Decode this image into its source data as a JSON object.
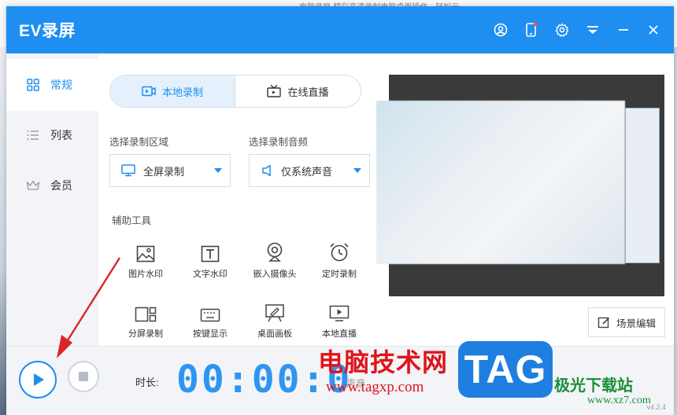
{
  "app": {
    "title": "EV录屏",
    "version": "v4.2.4"
  },
  "background_snippet": "电脑录屏·精彩高清录制电脑桌面操作，轻松云",
  "sidebar": {
    "items": [
      {
        "label": "常规",
        "icon": "grid-icon",
        "active": true
      },
      {
        "label": "列表",
        "icon": "list-icon",
        "active": false
      },
      {
        "label": "会员",
        "icon": "crown-icon",
        "active": false
      }
    ]
  },
  "mode_tabs": [
    {
      "label": "本地录制",
      "icon": "video-record-icon",
      "active": true
    },
    {
      "label": "在线直播",
      "icon": "tv-icon",
      "active": false
    }
  ],
  "record_area": {
    "label": "选择录制区域",
    "value": "全屏录制",
    "icon": "monitor-icon"
  },
  "record_audio": {
    "label": "选择录制音频",
    "value": "仅系统声音",
    "icon": "speaker-icon"
  },
  "tools": {
    "label": "辅助工具",
    "items": [
      {
        "label": "图片水印",
        "icon": "image-icon"
      },
      {
        "label": "文字水印",
        "icon": "text-icon"
      },
      {
        "label": "嵌入摄像头",
        "icon": "webcam-icon"
      },
      {
        "label": "定时录制",
        "icon": "alarm-clock-icon"
      },
      {
        "label": "分屏录制",
        "icon": "split-screen-icon"
      },
      {
        "label": "按键显示",
        "icon": "keyboard-icon"
      },
      {
        "label": "桌面画板",
        "icon": "drawing-board-icon"
      },
      {
        "label": "本地直播",
        "icon": "local-live-icon"
      }
    ]
  },
  "scene_edit": {
    "label": "场景编辑",
    "icon": "edit-icon"
  },
  "bottom": {
    "duration_label": "时长:",
    "timer": "00:00:0",
    "volume_label": "声音"
  },
  "watermark": {
    "cn_text": "电脑技术网",
    "url": "www.tagxp.com",
    "tag": "TAG",
    "jg_text": "极光下载站",
    "jg_url": "www.xz7.com"
  },
  "colors": {
    "accent": "#1e8ef0",
    "arrow": "#d9262b",
    "watermark_red": "#e0141b"
  }
}
